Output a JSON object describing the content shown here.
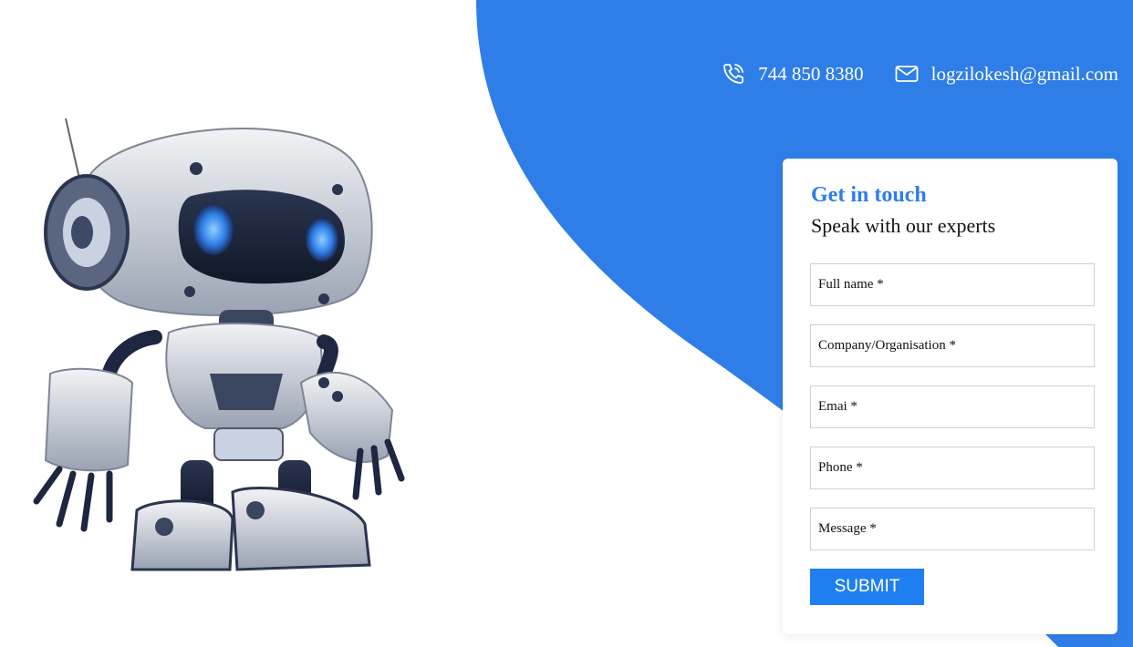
{
  "theme": {
    "accent": "#2e7de9",
    "panel_blue": "#2f7ee8",
    "button_blue": "#1f7ff0"
  },
  "header": {
    "phone": {
      "icon": "phone-icon",
      "text": "744 850 8380"
    },
    "email": {
      "icon": "mail-icon",
      "text": "logzilokesh@gmail.com"
    }
  },
  "hero": {
    "image": "robot-illustration"
  },
  "form": {
    "title": "Get in touch",
    "subtitle": "Speak with our experts",
    "fields": [
      {
        "placeholder": "Full name *"
      },
      {
        "placeholder": "Company/Organisation *"
      },
      {
        "placeholder": "Emai *"
      },
      {
        "placeholder": "Phone *"
      },
      {
        "placeholder": "Message *"
      }
    ],
    "submit_label": "SUBMIT"
  }
}
